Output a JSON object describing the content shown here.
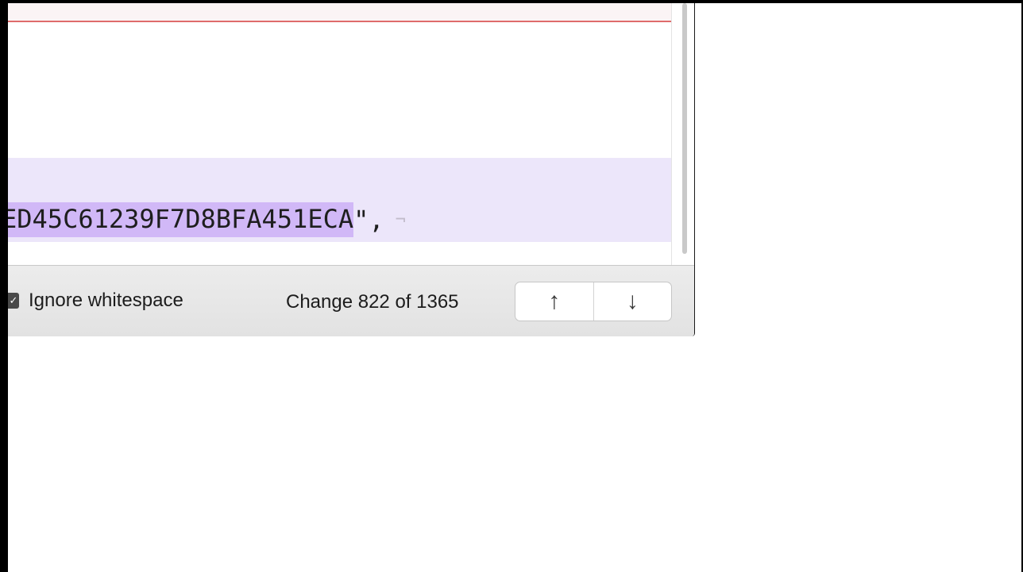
{
  "editor": {
    "highlighted_text": "ED45C61239F7D8BFA451ECA",
    "tail_text": "\",",
    "eol_marker": "¬"
  },
  "footer": {
    "checkbox_mark": "✓",
    "ignore_whitespace_label": "Ignore whitespace",
    "change_counter": "Change 822 of 1365",
    "prev_change_icon": "↑",
    "next_change_icon": "↓"
  },
  "colors": {
    "removed_line": "#df6b6b",
    "change_band": "#ece6fa",
    "change_highlight": "#d1b8f7"
  }
}
